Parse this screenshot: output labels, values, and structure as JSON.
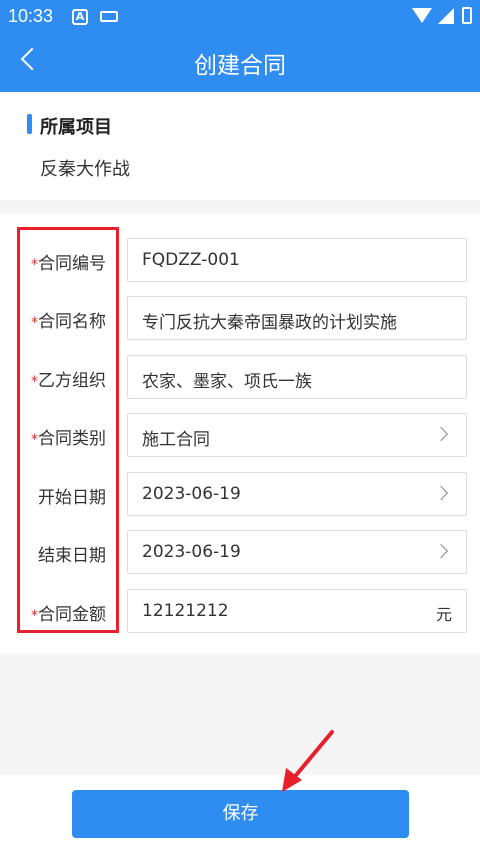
{
  "status_bar": {
    "time": "10:33",
    "a_badge": "A"
  },
  "nav": {
    "title": "创建合同",
    "back_icon": "chevron-left-icon"
  },
  "project": {
    "section_title": "所属项目",
    "name": "反秦大作战"
  },
  "form": {
    "rows": [
      {
        "required": true,
        "label": "合同编号",
        "value": "FQDZZ-001"
      },
      {
        "required": true,
        "label": "合同名称",
        "value": "专门反抗大秦帝国暴政的计划实施"
      },
      {
        "required": true,
        "label": "乙方组织",
        "value": "农家、墨家、项氏一族"
      },
      {
        "required": true,
        "label": "合同类别",
        "value": "施工合同",
        "chevron": true
      },
      {
        "required": false,
        "label": "开始日期",
        "value": "2023-06-19",
        "chevron": true
      },
      {
        "required": false,
        "label": "结束日期",
        "value": "2023-06-19",
        "chevron": true
      },
      {
        "required": true,
        "label": "合同金额",
        "value": "12121212",
        "unit": "元"
      }
    ],
    "required_mark": "*"
  },
  "footer": {
    "save_label": "保存"
  },
  "colors": {
    "primary": "#2f8cf0",
    "annotation": "#e8202a",
    "required": "#e03030"
  }
}
